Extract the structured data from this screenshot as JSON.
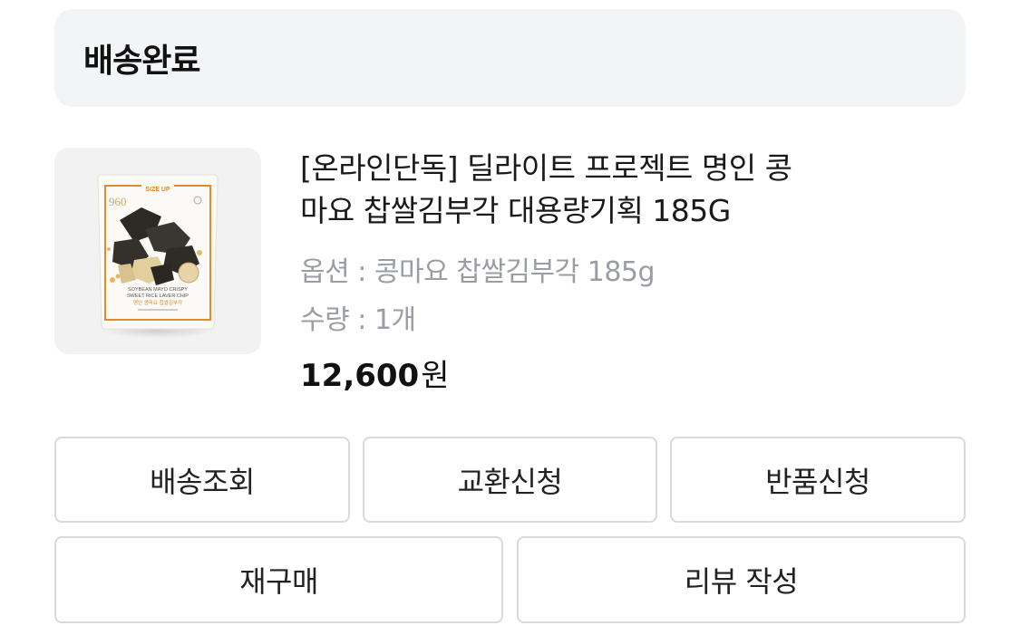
{
  "order": {
    "status_label": "배송완료"
  },
  "product": {
    "name_line1": "[온라인단독] 딜라이트 프로젝트 명인 콩",
    "name_line2": "마요 찹쌀김부각 대용량기획 185G",
    "option": "옵션 : 콩마요 찹쌀김부각 185g",
    "quantity": "수량 : 1개",
    "price_amount": "12,600",
    "price_unit": "원",
    "image": {
      "icon": "product-package-image",
      "package_badge": "SIZE UP",
      "package_logo": "960",
      "package_text_1": "SOYBEAN MAYO CRISPY",
      "package_text_2": "SWEET RICE LAVER CHIP",
      "package_text_kr": "명인 콩마요 찹쌀김부각",
      "accent_color": "#e08a2c"
    }
  },
  "actions": {
    "track_delivery": "배송조회",
    "exchange_request": "교환신청",
    "return_request": "반품신청",
    "reorder": "재구매",
    "write_review": "리뷰 작성"
  },
  "colors": {
    "status_background": "#f3f4f6",
    "button_border": "#d9dadd",
    "muted_text": "#9a9da3"
  }
}
